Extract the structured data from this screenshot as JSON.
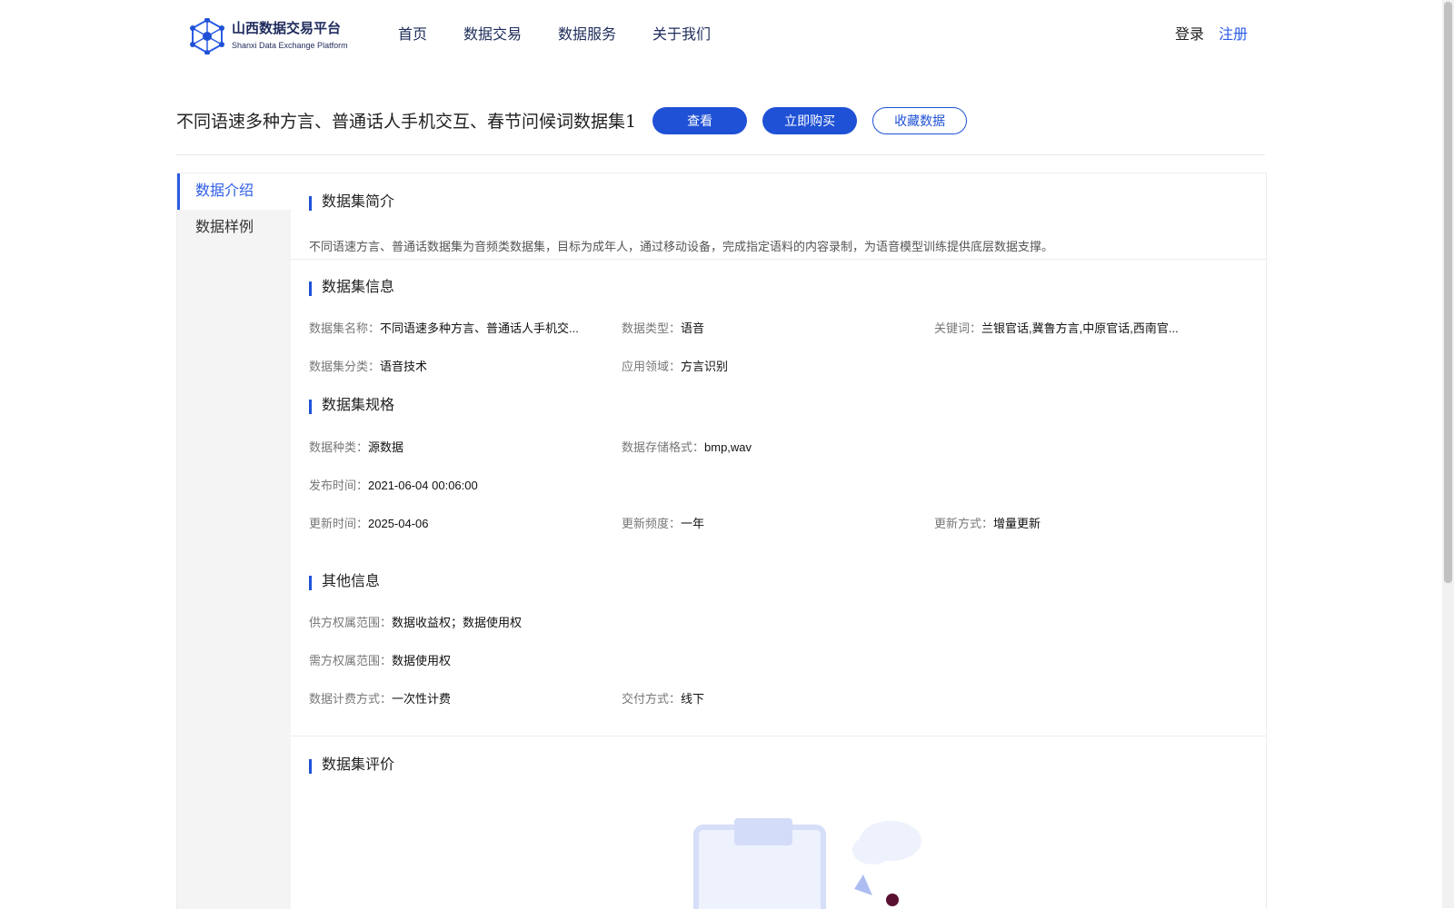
{
  "header": {
    "logo_cn": "山西数据交易平台",
    "logo_en": "Shanxi Data Exchange Platform",
    "nav": [
      "首页",
      "数据交易",
      "数据服务",
      "关于我们"
    ],
    "login": "登录",
    "register": "注册"
  },
  "dataset": {
    "title": "不同语速多种方言、普通话人手机交互、春节问候词数据集1",
    "buttons": {
      "view": "查看",
      "buy": "立即购买",
      "favorite": "收藏数据"
    }
  },
  "sidebar": {
    "items": [
      "数据介绍",
      "数据样例"
    ]
  },
  "sections": {
    "intro_title": "数据集简介",
    "intro_text": "不同语速方言、普通话数据集为音频类数据集，目标为成年人，通过移动设备，完成指定语料的内容录制，为语音模型训练提供底层数据支撑。",
    "info_title": "数据集信息",
    "spec_title": "数据集规格",
    "other_title": "其他信息",
    "review_title": "数据集评价"
  },
  "info": {
    "name_k": "数据集名称：",
    "name_v": "不同语速多种方言、普通话人手机交...",
    "type_k": "数据类型：",
    "type_v": "语音",
    "keyword_k": "关键词：",
    "keyword_v": "兰银官话,冀鲁方言,中原官话,西南官...",
    "category_k": "数据集分类：",
    "category_v": "语音技术",
    "domain_k": "应用领域：",
    "domain_v": "方言识别"
  },
  "spec": {
    "kind_k": "数据种类：",
    "kind_v": "源数据",
    "format_k": "数据存储格式：",
    "format_v": "bmp,wav",
    "publish_k": "发布时间：",
    "publish_v": "2021-06-04 00:06:00",
    "update_k": "更新时间：",
    "update_v": "2025-04-06",
    "freq_k": "更新频度：",
    "freq_v": "一年",
    "mode_k": "更新方式：",
    "mode_v": "增量更新"
  },
  "other": {
    "supply_k": "供方权属范围：",
    "supply_v": "数据收益权；数据使用权",
    "demand_k": "需方权属范围：",
    "demand_v": "数据使用权",
    "billing_k": "数据计费方式：",
    "billing_v": "一次性计费",
    "delivery_k": "交付方式：",
    "delivery_v": "线下"
  },
  "colors": {
    "accent": "#1f51d6",
    "link": "#2b5ce6",
    "nav": "#1d2c5a"
  }
}
